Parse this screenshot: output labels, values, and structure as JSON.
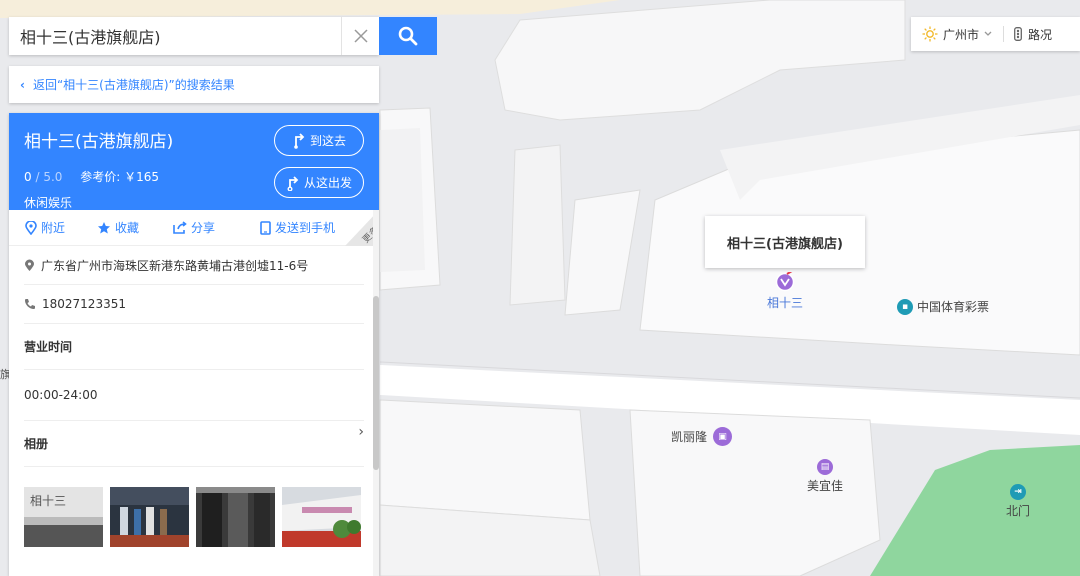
{
  "search": {
    "value": "相十三(古港旗舰店)"
  },
  "back_link": "返回“相十三(古港旗舰店)”的搜索结果",
  "place": {
    "name": "相十三(古港旗舰店)",
    "score": "0",
    "score_max": "/ 5.0",
    "price": "参考价: ￥165",
    "category": "休闲娱乐",
    "go_here": "到这去",
    "start_here": "从这出发"
  },
  "actions": {
    "nearby": "附近",
    "favorite": "收藏",
    "share": "分享",
    "send_phone": "发送到手机",
    "more": "更多"
  },
  "details": {
    "address": "广东省广州市海珠区新港东路黄埔古港创墟11-6号",
    "phone": "18027123351",
    "hours_title": "营业时间",
    "hours": "00:00-24:00",
    "album_title": "相册"
  },
  "photos": [
    "相十三"
  ],
  "topright": {
    "city": "广州市",
    "traffic": "路况"
  },
  "map": {
    "callout": "相十三(古港旗舰店)",
    "marker_label": "相十三",
    "pois": [
      {
        "label": "中国体育彩票",
        "color": "#1f9bb5"
      },
      {
        "label": "凯丽隆",
        "color": "#9c6bd8"
      },
      {
        "label": "美宜佳",
        "color": "#9c6bd8"
      },
      {
        "label": "北门",
        "color": "#1f9bb5"
      }
    ],
    "edge_label": "旗"
  },
  "colors": {
    "accent": "#3385ff",
    "park": "#8fd69e",
    "building": "#f8f8f8",
    "road": "#ffffff"
  }
}
